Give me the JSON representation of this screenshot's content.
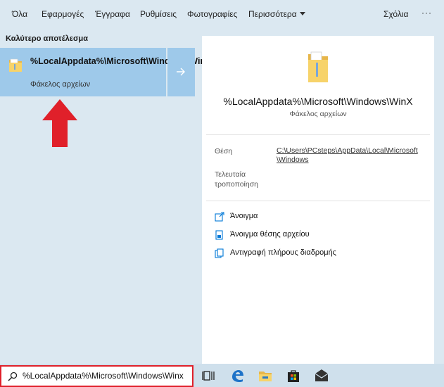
{
  "tabs": {
    "all": "Όλα",
    "apps": "Εφαρμογές",
    "documents": "Έγγραφα",
    "settings": "Ρυθμίσεις",
    "photos": "Φωτογραφίες",
    "more": "Περισσότερα",
    "feedback": "Σχόλια",
    "menu": "···"
  },
  "best_match": {
    "section_title": "Καλύτερο αποτέλεσμα",
    "name": "%LocalAppdata%\\Microsoft\\Windows\\WinX",
    "type": "Φάκελος αρχείων"
  },
  "details": {
    "title": "%LocalAppdata%\\Microsoft\\Windows\\WinX",
    "subtitle": "Φάκελος αρχείων",
    "location_label": "Θέση",
    "location_value": "C:\\Users\\PCsteps\\AppData\\Local\\Microsoft\\Windows",
    "modified_label": "Τελευταία τροποποίηση",
    "actions": {
      "open": "Άνοιγμα",
      "open_location": "Άνοιγμα θέσης αρχείου",
      "copy_path": "Αντιγραφή πλήρους διαδρομής"
    }
  },
  "search": {
    "query": "%LocalAppdata%\\Microsoft\\Windows\\Winx"
  },
  "taskbar": {
    "icons": [
      "task-view-icon",
      "edge-icon",
      "file-explorer-icon",
      "store-icon",
      "mail-icon"
    ]
  },
  "colors": {
    "accent": "#0078d7",
    "highlight": "#9ec9ea",
    "annotation_red": "#e0202a"
  }
}
